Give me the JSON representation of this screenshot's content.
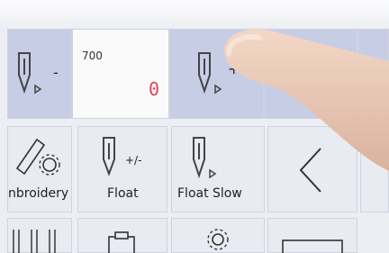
{
  "top_row": {
    "speed_minus_label": "-",
    "stitch_counter": {
      "max_speed": "700",
      "value": "0"
    },
    "speed_plus_label": "+"
  },
  "middle_row": {
    "embroidery_label": "nbroidery",
    "float_toggle_label": "+/-",
    "float_label": "Float",
    "float_slow_label": "Float Slow"
  },
  "colors": {
    "accent_tile": "#c8cde6",
    "counter_value": "#e0445e"
  },
  "icons": [
    "needle-minus-icon",
    "needle-plus-icon",
    "pen-gear-icon",
    "needle-float-icon",
    "needle-slow-icon",
    "chevron-left-icon",
    "needles-icon",
    "clipboard-icon",
    "gear-icon",
    "frame-icon"
  ]
}
